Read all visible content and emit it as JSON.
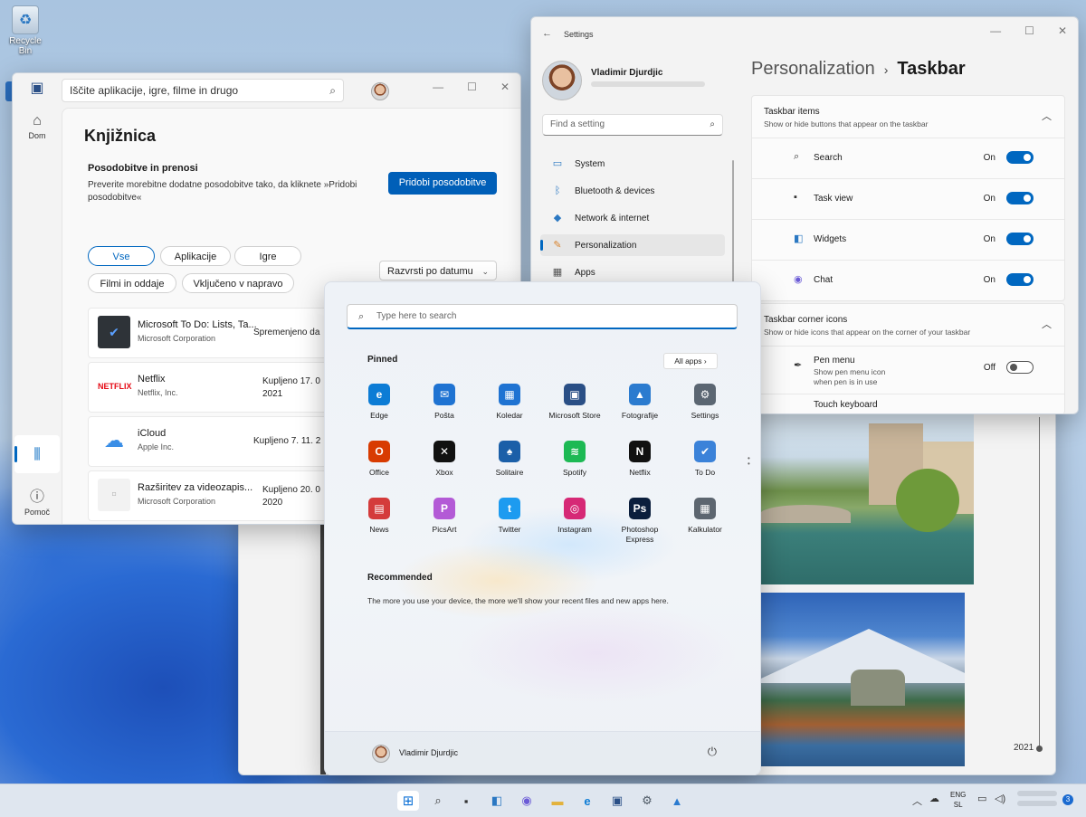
{
  "desktop": {
    "recycle_bin": "Recycle Bin"
  },
  "photos": {
    "year": "2021"
  },
  "store": {
    "search_placeholder": "Iščite aplikacije, igre, filme in drugo",
    "nav_home": "Dom",
    "nav_help": "Pomoč",
    "title": "Knjižnica",
    "updates_title": "Posodobitve in prenosi",
    "updates_desc": "Preverite morebitne dodatne posodobitve tako, da kliknete »Pridobi posodobitve«",
    "updates_button": "Pridobi posodobitve",
    "filters": [
      "Vse",
      "Aplikacije",
      "Igre",
      "Filmi in oddaje",
      "Vključeno v napravo"
    ],
    "sort_label": "Razvrsti po datumu",
    "apps": [
      {
        "name": "Microsoft To Do: Lists, Ta...",
        "publisher": "Microsoft Corporation",
        "date": "Spremenjeno da"
      },
      {
        "name": "Netflix",
        "publisher": "Netflix, Inc.",
        "date": "Kupljeno 17. 0 2021"
      },
      {
        "name": "iCloud",
        "publisher": "Apple Inc.",
        "date": "Kupljeno 7. 11. 2"
      },
      {
        "name": "Razširitev za videozapis...",
        "publisher": "Microsoft Corporation",
        "date": "Kupljeno 20. 0 2020"
      }
    ],
    "netflix_logo": "NETFLIX"
  },
  "settings": {
    "window_title": "Settings",
    "user_name": "Vladimir Djurdjic",
    "find_placeholder": "Find a setting",
    "nav": [
      {
        "label": "System",
        "icon": "monitor-icon"
      },
      {
        "label": "Bluetooth & devices",
        "icon": "bluetooth-icon"
      },
      {
        "label": "Network & internet",
        "icon": "wifi-icon"
      },
      {
        "label": "Personalization",
        "icon": "brush-icon"
      },
      {
        "label": "Apps",
        "icon": "apps-icon"
      }
    ],
    "breadcrumb_parent": "Personalization",
    "breadcrumb_current": "Taskbar",
    "taskbar_items": {
      "title": "Taskbar items",
      "subtitle": "Show or hide buttons that appear on the taskbar",
      "rows": [
        {
          "label": "Search",
          "state": "On"
        },
        {
          "label": "Task view",
          "state": "On"
        },
        {
          "label": "Widgets",
          "state": "On"
        },
        {
          "label": "Chat",
          "state": "On"
        }
      ]
    },
    "corner_icons": {
      "title": "Taskbar corner icons",
      "subtitle": "Show or hide icons that appear on the corner of your taskbar",
      "pen_label": "Pen menu",
      "pen_sub": "Show pen menu icon when pen is in use",
      "pen_state": "Off",
      "touch_label": "Touch keyboard"
    }
  },
  "start": {
    "search_placeholder": "Type here to search",
    "pinned_label": "Pinned",
    "all_apps_label": "All apps",
    "apps": [
      {
        "label": "Edge",
        "color": "#0c7cd5",
        "glyph": "e"
      },
      {
        "label": "Pošta",
        "color": "#1f73d2",
        "glyph": "✉"
      },
      {
        "label": "Koledar",
        "color": "#1f73d2",
        "glyph": "▦"
      },
      {
        "label": "Microsoft Store",
        "color": "#2a4f86",
        "glyph": "▣"
      },
      {
        "label": "Fotografije",
        "color": "#2b7bcf",
        "glyph": "▲"
      },
      {
        "label": "Settings",
        "color": "#5b6672",
        "glyph": "⚙"
      },
      {
        "label": "Office",
        "color": "#d83b01",
        "glyph": "O"
      },
      {
        "label": "Xbox",
        "color": "#111111",
        "glyph": "✕"
      },
      {
        "label": "Solitaire",
        "color": "#1b5fa8",
        "glyph": "♠"
      },
      {
        "label": "Spotify",
        "color": "#1db954",
        "glyph": "≋"
      },
      {
        "label": "Netflix",
        "color": "#111111",
        "glyph": "N"
      },
      {
        "label": "To Do",
        "color": "#3b82d9",
        "glyph": "✔"
      },
      {
        "label": "News",
        "color": "#d43b3b",
        "glyph": "▤"
      },
      {
        "label": "PicsArt",
        "color": "#b35ad6",
        "glyph": "P"
      },
      {
        "label": "Twitter",
        "color": "#1d9bf0",
        "glyph": "t"
      },
      {
        "label": "Instagram",
        "color": "#d62976",
        "glyph": "◎"
      },
      {
        "label": "Photoshop Express",
        "color": "#0b1e3c",
        "glyph": "Ps"
      },
      {
        "label": "Kalkulator",
        "color": "#5d6670",
        "glyph": "▦"
      }
    ],
    "recommended_label": "Recommended",
    "recommended_text": "The more you use your device, the more we'll show your recent files and new apps here.",
    "user_name": "Vladimir Djurdjic"
  },
  "taskbar": {
    "lang_line1": "ENG",
    "lang_line2": "SL",
    "notification_count": "3"
  }
}
